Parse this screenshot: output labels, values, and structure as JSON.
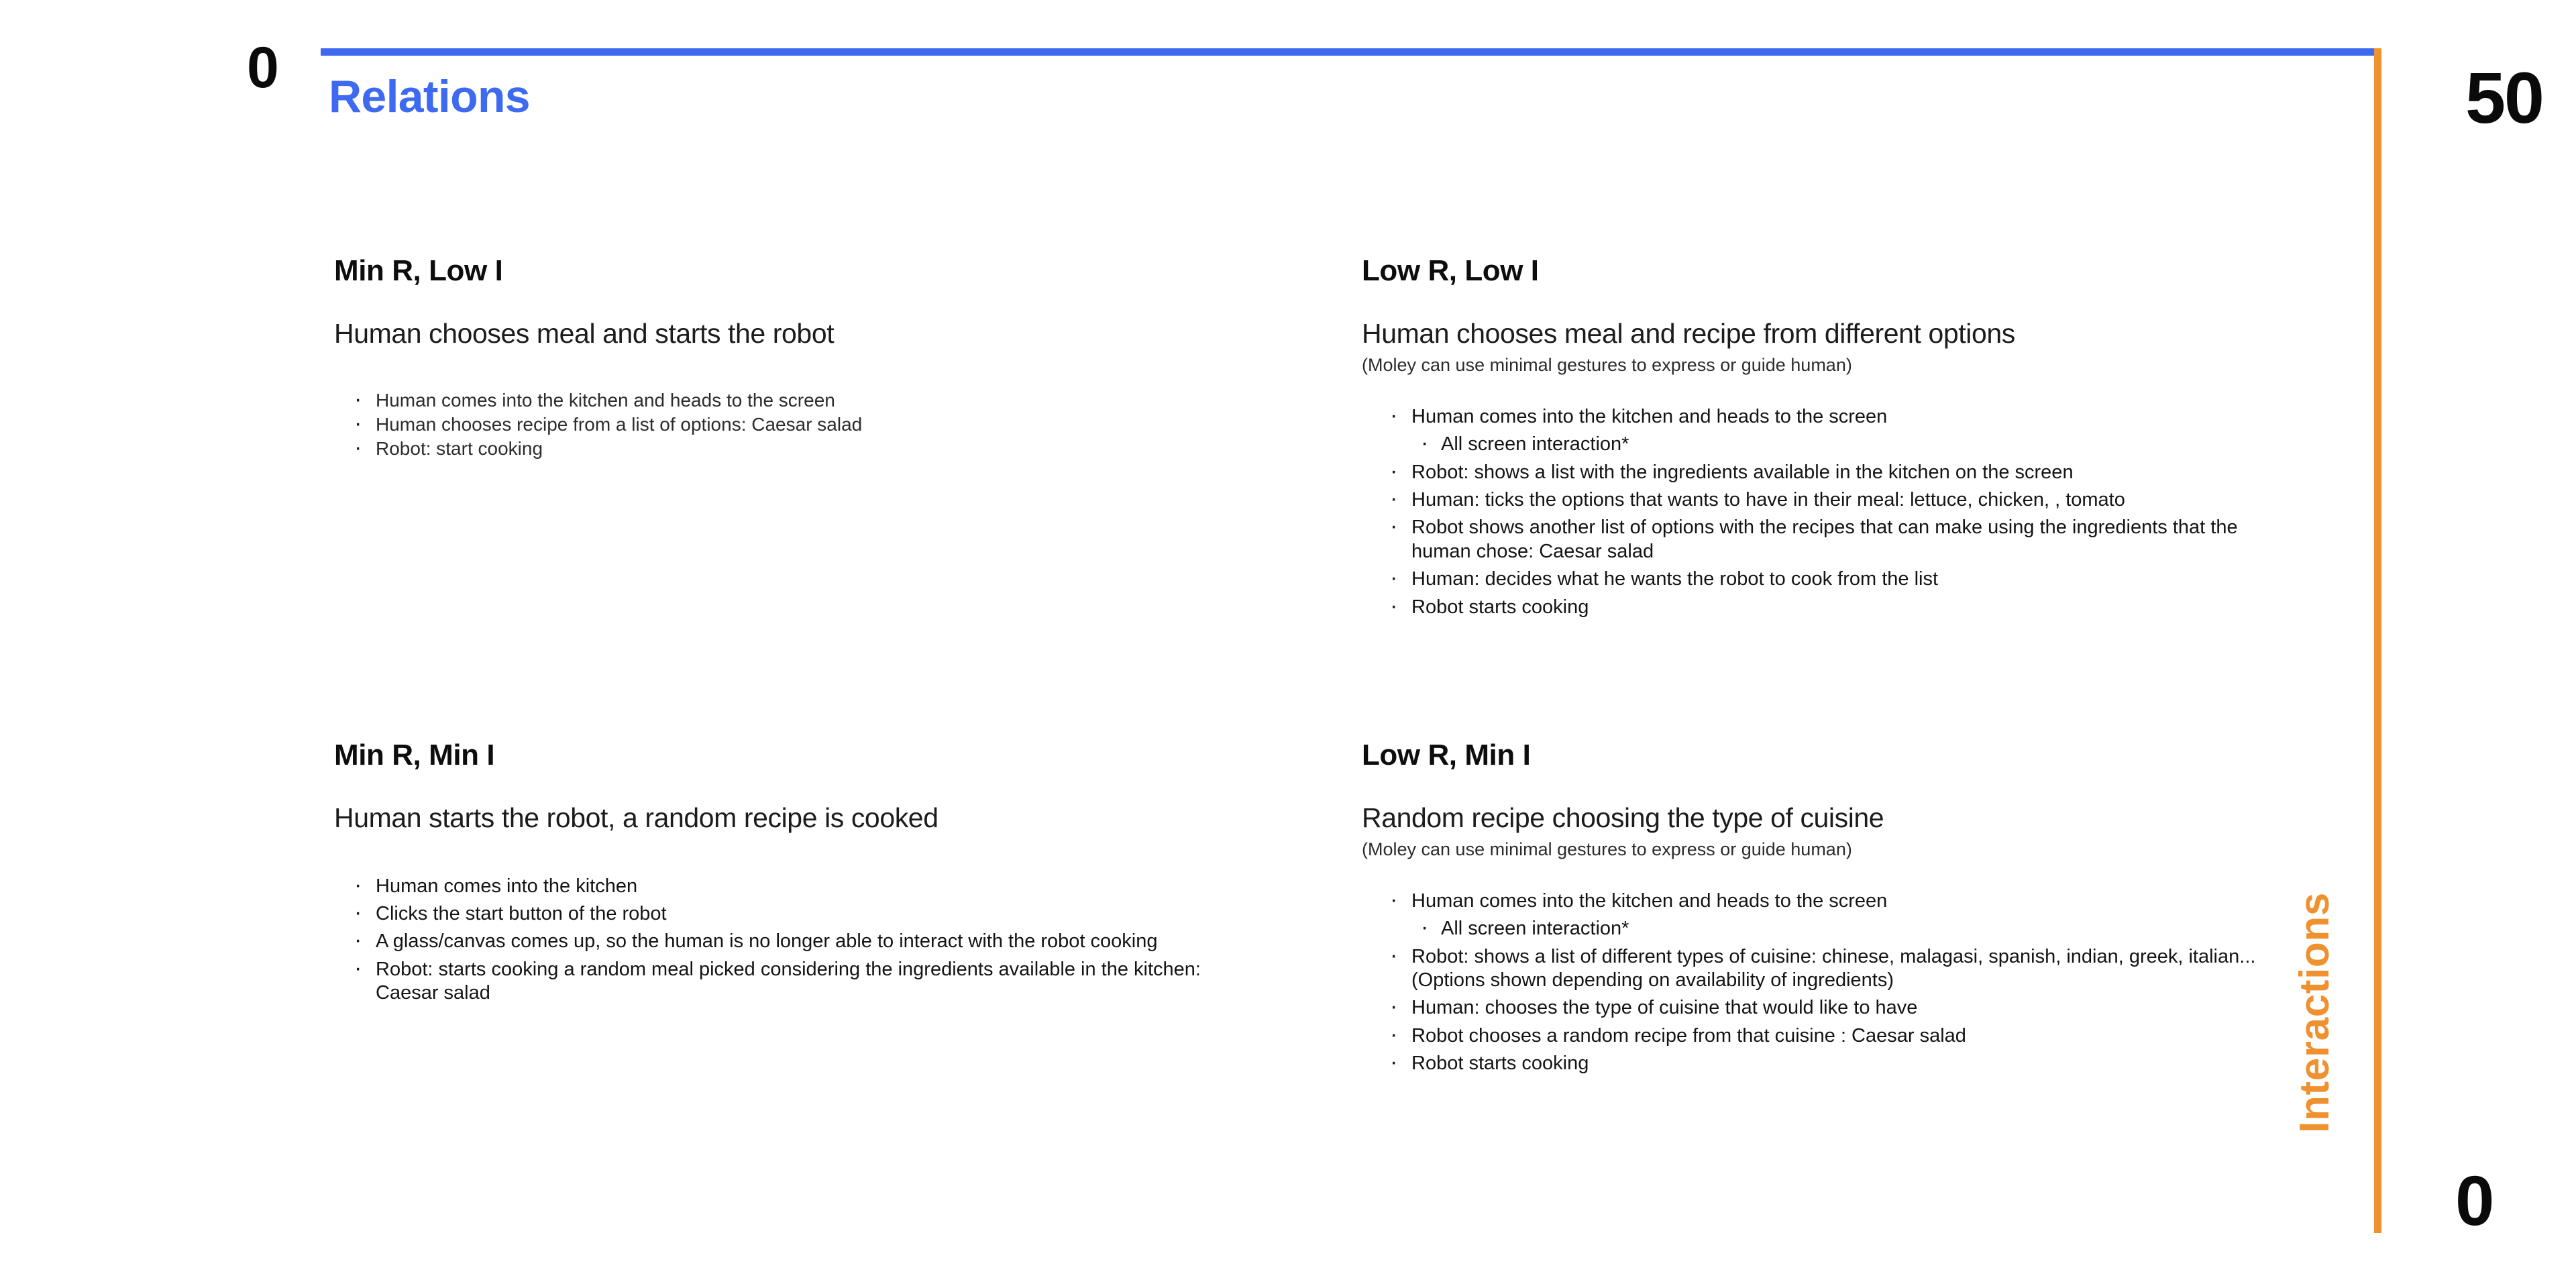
{
  "axes": {
    "horizontal": {
      "label": "Relations",
      "color": "#3d6af0",
      "min_value": "0",
      "max_value": "50"
    },
    "vertical": {
      "label": "Interactions",
      "color": "#f0912f",
      "min_value": "0"
    }
  },
  "quadrants": [
    {
      "id": "min-r-low-i",
      "title": "Min R, Low I",
      "subtitle": "Human chooses meal and starts the robot",
      "note": "",
      "steps": [
        {
          "text": "Human comes into the kitchen and heads to the screen",
          "level": 0
        },
        {
          "text": "Human chooses recipe from a list of options: Caesar salad",
          "level": 0
        },
        {
          "text": "Robot: start cooking",
          "level": 0
        }
      ]
    },
    {
      "id": "low-r-low-i",
      "title": "Low R, Low I",
      "subtitle": "Human chooses meal and recipe from different options",
      "note": "(Moley can use minimal gestures to express or guide human)",
      "steps": [
        {
          "text": "Human comes into the kitchen and heads to the screen",
          "level": 0
        },
        {
          "text": "All screen interaction*",
          "level": 1
        },
        {
          "text": "Robot: shows a list with the ingredients available in the kitchen on the screen",
          "level": 0
        },
        {
          "text": "Human: ticks the options that wants to have in their meal: lettuce, chicken, , tomato",
          "level": 0
        },
        {
          "text": "Robot shows another list of options with the recipes that can make using the ingredients that the human chose: Caesar salad",
          "level": 0
        },
        {
          "text": "Human: decides what he wants the robot to cook from the list",
          "level": 0
        },
        {
          "text": "Robot starts cooking",
          "level": 0
        }
      ]
    },
    {
      "id": "min-r-min-i",
      "title": "Min R, Min I",
      "subtitle": "Human starts the robot, a random recipe is cooked",
      "note": "",
      "steps": [
        {
          "text": "Human comes into the kitchen",
          "level": 0
        },
        {
          "text": "Clicks the start button of the robot",
          "level": 0
        },
        {
          "text": "A glass/canvas comes up, so the human is no longer able to interact with the robot cooking",
          "level": 0
        },
        {
          "text": "Robot: starts cooking a random meal picked considering the ingredients available in the kitchen: Caesar salad",
          "level": 0
        }
      ]
    },
    {
      "id": "low-r-min-i",
      "title": "Low R, Min I",
      "subtitle": "Random recipe choosing the type of cuisine",
      "note": "(Moley can use minimal gestures to express or guide human)",
      "steps": [
        {
          "text": "Human comes into the kitchen and heads to the screen",
          "level": 0
        },
        {
          "text": "All screen interaction*",
          "level": 1
        },
        {
          "text": "Robot: shows a list of different types of cuisine: chinese, malagasi, spanish, indian, greek, italian...(Options shown depending on availability of ingredients)",
          "level": 0
        },
        {
          "text": "Human: chooses the type of cuisine that would like to have",
          "level": 0
        },
        {
          "text": "Robot chooses a random recipe from that cuisine : Caesar salad",
          "level": 0
        },
        {
          "text": "Robot starts cooking",
          "level": 0
        }
      ]
    }
  ]
}
